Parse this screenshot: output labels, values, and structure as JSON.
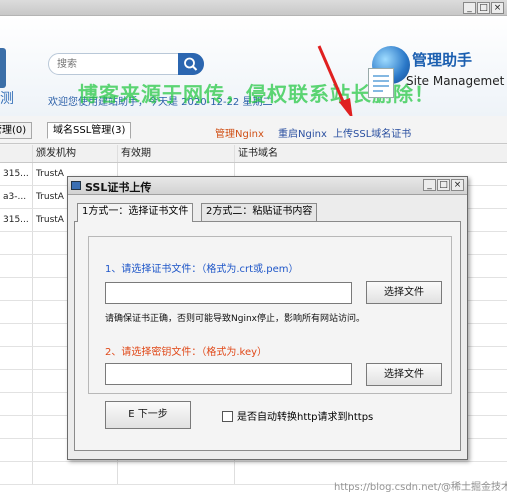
{
  "app": {
    "window_buttons": [
      "_",
      "□",
      "×"
    ],
    "left_nav_partial": "测",
    "search": {
      "placeholder": "搜索",
      "value": ""
    },
    "welcome": "欢迎您使用建站助手，今天是 2020-12-22 星期二",
    "overlay_watermark": "博客来源于网传，侵权联系站长删除！",
    "brand": {
      "title": "管理助手",
      "subtitle": "Site Managemet"
    },
    "colors": {
      "accent": "#2b66b0",
      "link_orange": "#d05016",
      "link_blue": "#2a4fa0",
      "watermark_green": "#28c846",
      "arrow_red": "#e02020"
    }
  },
  "tabs": [
    {
      "label": "管理(0)",
      "active": false
    },
    {
      "label": "域名SSL管理(3)",
      "active": true
    }
  ],
  "toolbar_links": {
    "manage_nginx": "管理Nginx",
    "restart_nginx": "重启Nginx",
    "upload_ssl": "上传SSL域名证书"
  },
  "table": {
    "columns": [
      "",
      "颁发机构",
      "有效期",
      "证书域名"
    ],
    "rows": [
      [
        "315...",
        "TrustA",
        "",
        ""
      ],
      [
        "a3-...",
        "TrustA",
        "",
        ""
      ],
      [
        "315...",
        "TrustA",
        "",
        ""
      ]
    ]
  },
  "dialog": {
    "title": "SSL证书上传",
    "window_buttons": [
      "_",
      "□",
      "×"
    ],
    "tabs": [
      {
        "label": "1方式一：选择证书文件",
        "active": true
      },
      {
        "label": "2方式二：粘贴证书内容",
        "active": false
      }
    ],
    "cert_label": "1、请选择证书文件：（格式为.crt或.pem）",
    "cert_value": "",
    "browse_label": "选择文件",
    "note": "请确保证书正确，否则可能导致Nginx停止，影响所有网站访问。",
    "key_label": "2、请选择密钥文件：（格式为.key）",
    "key_value": "",
    "next_label": "E 下一步",
    "auto_https_label": "是否自动转换http请求到https",
    "auto_https_checked": false
  },
  "footer_watermark": "https://blog.csdn.net/@稀土掘金技术社区"
}
